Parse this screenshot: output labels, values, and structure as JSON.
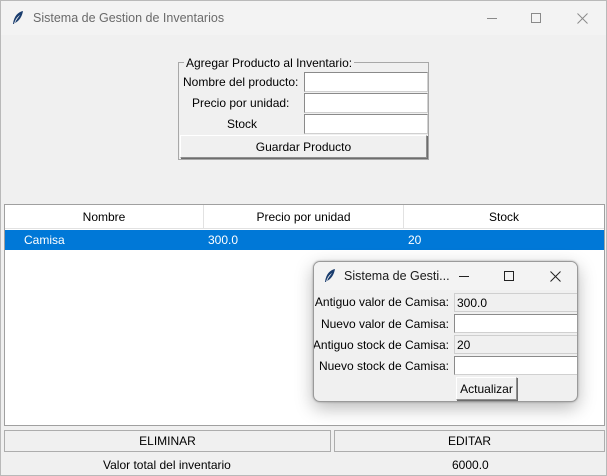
{
  "window": {
    "title": "Sistema de Gestion de Inventarios",
    "icon": "feather-icon"
  },
  "form": {
    "legend": "Agregar Producto al Inventario:",
    "name_label": "Nombre del producto:",
    "name_value": "",
    "price_label": "Precio por unidad:",
    "price_value": "",
    "stock_label": "Stock",
    "stock_value": "",
    "save_button": "Guardar Producto"
  },
  "table": {
    "columns": [
      "Nombre",
      "Precio por unidad",
      "Stock"
    ],
    "rows": [
      {
        "name": "Camisa",
        "price": "300.0",
        "stock": "20",
        "selected": true
      }
    ]
  },
  "actions": {
    "delete_button": "ELIMINAR",
    "edit_button": "EDITAR"
  },
  "footer": {
    "total_label": "Valor total del inventario",
    "total_value": "6000.0"
  },
  "dialog": {
    "title": "Sistema de Gesti...",
    "old_value_label": "Antiguo valor de Camisa:",
    "old_value": "300.0",
    "new_value_label": "Nuevo valor de Camisa:",
    "new_value": "",
    "old_stock_label": "Antiguo stock de Camisa:",
    "old_stock": "20",
    "new_stock_label": "Nuevo stock de Camisa:",
    "new_stock": "",
    "update_button": "Actualizar"
  },
  "colors": {
    "selection": "#0078d7",
    "background": "#f0f0f0"
  }
}
